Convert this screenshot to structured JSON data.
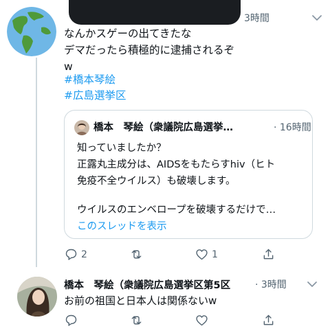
{
  "reply1": {
    "time": "3時間",
    "lines": [
      "なんかスゲーの出てきたな",
      "デマだったら積極的に逮捕されるぞ",
      "w"
    ],
    "hashtags": [
      "#橋本琴絵",
      "#広島選挙区"
    ]
  },
  "quote": {
    "author": "橋本　琴絵（衆議院広島選挙…",
    "time": "· 16時間",
    "lines": [
      "知っていましたか？",
      "正露丸主成分は、AIDSをもたらすhiv（ヒト",
      "免疫不全ウイルス）も破壊します。",
      "",
      "ウイルスのエンベロープを破壊するだけで…"
    ],
    "show_thread": "このスレッドを表示"
  },
  "actions1": {
    "reply_count": "2",
    "retweet_count": "",
    "like_count": "1"
  },
  "reply2": {
    "author": "橋本　琴絵（衆議院広島選挙区第5区",
    "time": "· 3時間",
    "text": "お前の祖国と日本人は関係ないw"
  },
  "colors": {
    "link": "#1d9bf0",
    "muted": "#536471",
    "border": "#cfd9de"
  },
  "icons": [
    "reply-icon",
    "retweet-icon",
    "like-icon",
    "share-icon",
    "chevron-down-icon",
    "globe-avatar"
  ]
}
